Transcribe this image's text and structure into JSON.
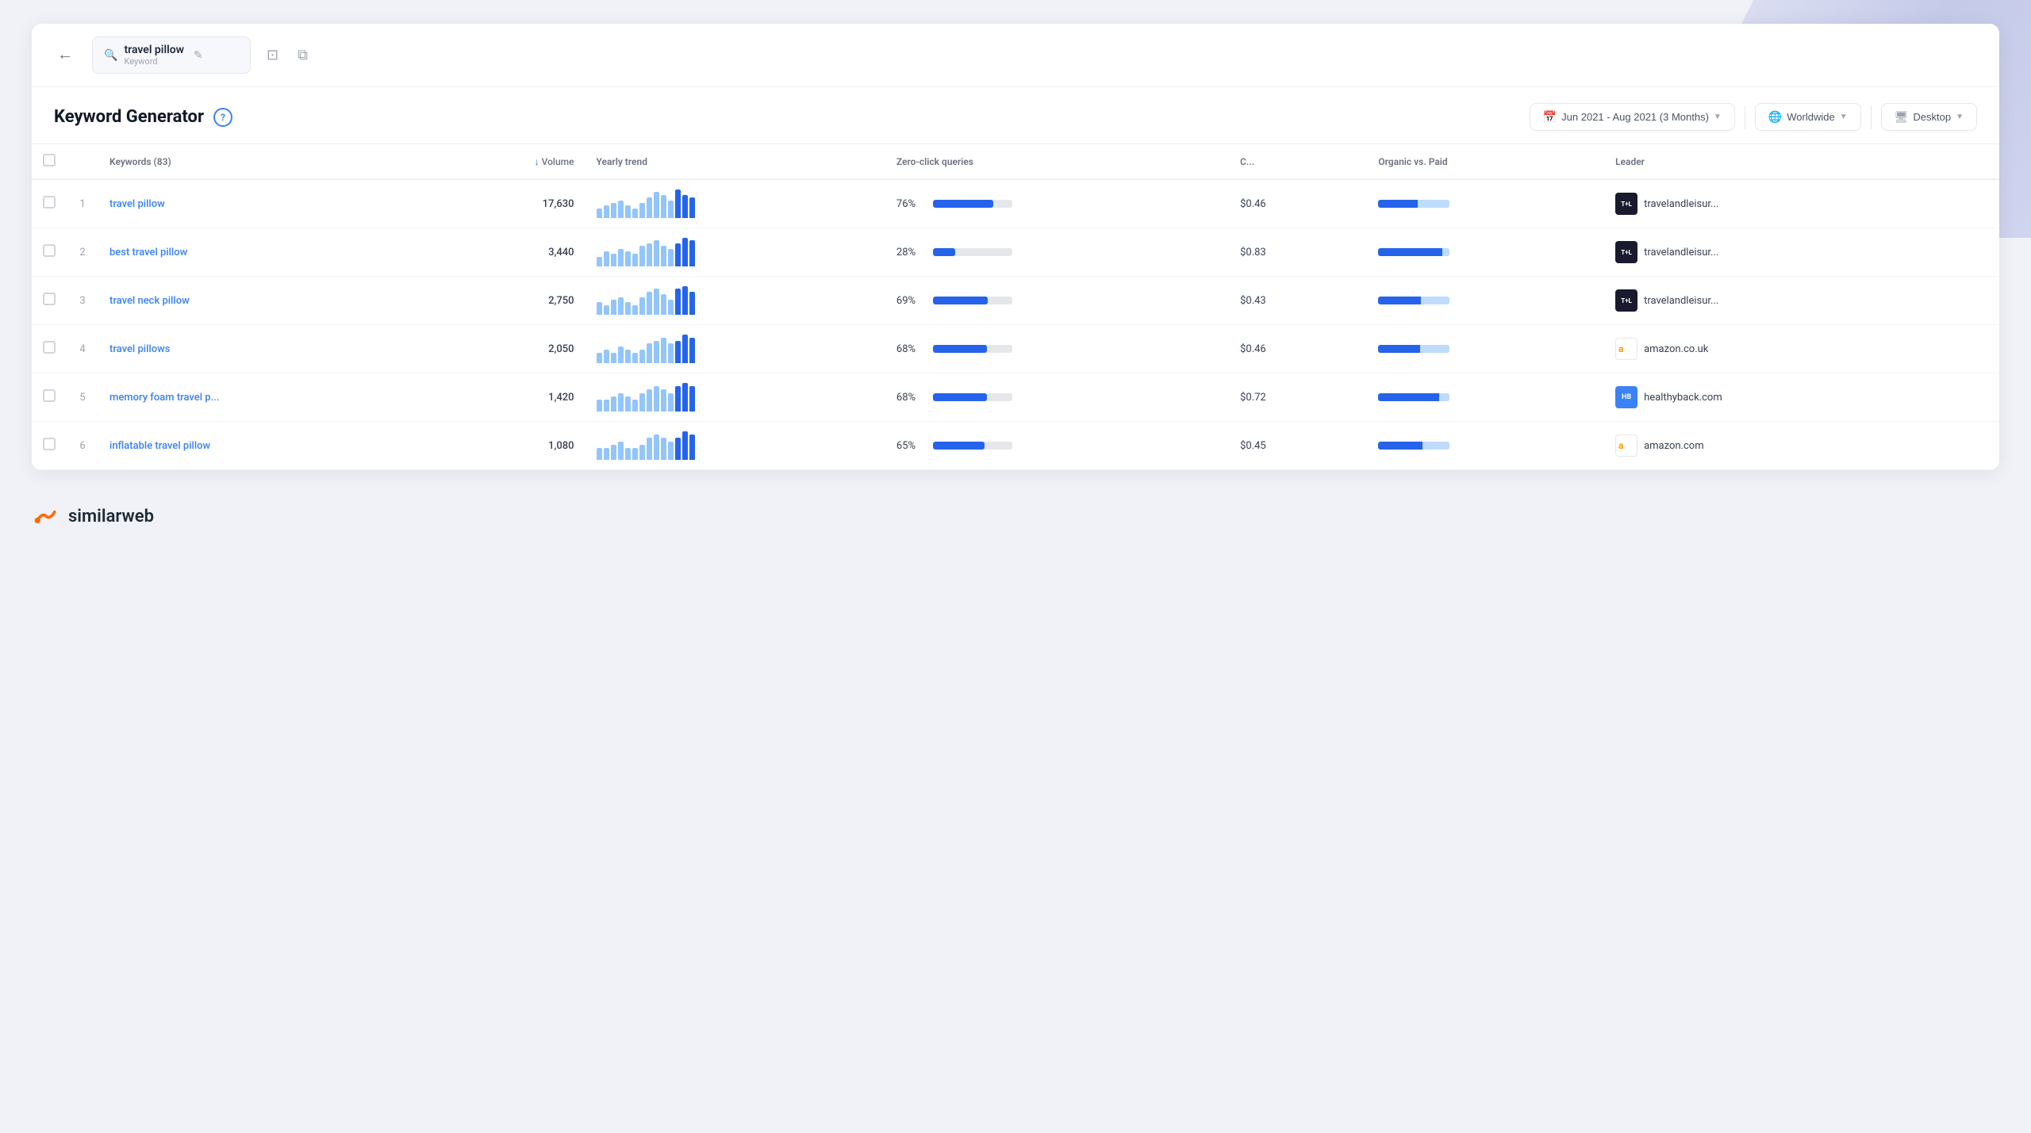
{
  "background_decoration": true,
  "topbar": {
    "back_label": "←",
    "search_query": "travel pillow",
    "search_type": "Keyword",
    "edit_icon": "✎",
    "clone_icon": "⊞",
    "external_icon": "⧉"
  },
  "page_header": {
    "title": "Keyword Generator",
    "help": "?",
    "date_filter": "Jun 2021 - Aug 2021 (3 Months)",
    "region_filter": "Worldwide",
    "device_filter": "Desktop"
  },
  "table": {
    "headers": {
      "checkbox": "",
      "num": "",
      "keywords": "Keywords (83)",
      "volume": "Volume",
      "yearly_trend": "Yearly trend",
      "zero_click": "Zero-click queries",
      "cpc": "C...",
      "organic_paid": "Organic vs. Paid",
      "leader": "Leader"
    },
    "rows": [
      {
        "num": 1,
        "keyword": "travel pillow",
        "volume": "17,630",
        "trend_bars": [
          3,
          4,
          5,
          6,
          4,
          3,
          5,
          7,
          9,
          8,
          6,
          10,
          8,
          7
        ],
        "trend_highlights": [
          11,
          12,
          13
        ],
        "zero_click_pct": "76%",
        "zero_click_fill": 76,
        "cpc": "$0.46",
        "organic_fill": 55,
        "paid_fill": 45,
        "leader_type": "tl",
        "leader_name": "travelandleisur..."
      },
      {
        "num": 2,
        "keyword": "best travel pillow",
        "volume": "3,440",
        "trend_bars": [
          3,
          5,
          4,
          6,
          5,
          4,
          7,
          8,
          9,
          7,
          6,
          8,
          10,
          9
        ],
        "trend_highlights": [
          11,
          12,
          13
        ],
        "zero_click_pct": "28%",
        "zero_click_fill": 28,
        "cpc": "$0.83",
        "organic_fill": 90,
        "paid_fill": 10,
        "leader_type": "tl",
        "leader_name": "travelandleisur..."
      },
      {
        "num": 3,
        "keyword": "travel neck pillow",
        "volume": "2,750",
        "trend_bars": [
          4,
          3,
          5,
          6,
          4,
          3,
          6,
          8,
          9,
          7,
          5,
          9,
          10,
          8
        ],
        "trend_highlights": [
          11,
          12,
          13
        ],
        "zero_click_pct": "69%",
        "zero_click_fill": 69,
        "cpc": "$0.43",
        "organic_fill": 60,
        "paid_fill": 40,
        "leader_type": "tl",
        "leader_name": "travelandleisur..."
      },
      {
        "num": 4,
        "keyword": "travel pillows",
        "volume": "2,050",
        "trend_bars": [
          3,
          4,
          3,
          5,
          4,
          3,
          4,
          6,
          7,
          8,
          6,
          7,
          9,
          8
        ],
        "trend_highlights": [
          11,
          12,
          13
        ],
        "zero_click_pct": "68%",
        "zero_click_fill": 68,
        "cpc": "$0.46",
        "organic_fill": 58,
        "paid_fill": 42,
        "leader_type": "amazon-uk",
        "leader_name": "amazon.co.uk"
      },
      {
        "num": 5,
        "keyword": "memory foam travel p...",
        "volume": "1,420",
        "trend_bars": [
          3,
          3,
          4,
          5,
          4,
          3,
          5,
          6,
          7,
          6,
          5,
          7,
          8,
          7
        ],
        "trend_highlights": [
          11,
          12,
          13
        ],
        "zero_click_pct": "68%",
        "zero_click_fill": 68,
        "cpc": "$0.72",
        "organic_fill": 85,
        "paid_fill": 15,
        "leader_type": "healthyback",
        "leader_name": "healthyback.com"
      },
      {
        "num": 6,
        "keyword": "inflatable travel pillow",
        "volume": "1,080",
        "trend_bars": [
          3,
          3,
          4,
          5,
          3,
          3,
          4,
          6,
          7,
          6,
          5,
          6,
          8,
          7
        ],
        "trend_highlights": [
          11,
          12,
          13
        ],
        "zero_click_pct": "65%",
        "zero_click_fill": 65,
        "cpc": "$0.45",
        "organic_fill": 62,
        "paid_fill": 38,
        "leader_type": "amazon",
        "leader_name": "amazon.com"
      }
    ]
  },
  "footer": {
    "brand": "similarweb"
  }
}
